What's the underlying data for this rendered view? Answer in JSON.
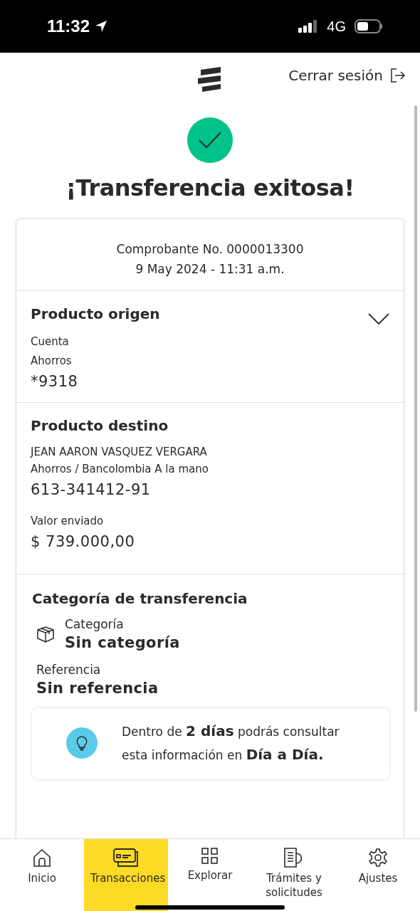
{
  "status_bar": {
    "time": "11:32",
    "network": "4G"
  },
  "header": {
    "logout": "Cerrar sesión"
  },
  "title": "¡Transferencia exitosa!",
  "receipt": {
    "number": "Comprobante No. 0000013300",
    "date": "9 May 2024 - 11:31 a.m."
  },
  "origin": {
    "heading": "Producto origen",
    "expanded": false,
    "type": "Cuenta",
    "subtype": "Ahorros",
    "account": "*9318"
  },
  "destination": {
    "heading": "Producto destino",
    "name": "JEAN AARON VASQUEZ VERGARA",
    "bank": "Ahorros / Bancolombia A la mano",
    "account": "613-341412-91",
    "amount_label": "Valor enviado",
    "amount": "$ 739.000,00"
  },
  "category": {
    "heading": "Categoría de transferencia",
    "category_label": "Categoría",
    "category_value": "Sin categoría",
    "reference_label": "Referencia",
    "reference_value": "Sin referencia"
  },
  "tip": "Dentro de **2 días** podrás consultar esta información en **Día a Día.**",
  "nav": [
    {
      "label": "Inicio",
      "kind": "home",
      "selected": false
    },
    {
      "label": "Transacciones",
      "kind": "cards",
      "selected": true
    },
    {
      "label": "Explorar",
      "kind": "grid",
      "selected": false
    },
    {
      "label": "Trámites y solicitudes",
      "kind": "docs",
      "selected": false
    },
    {
      "label": "Ajustes",
      "kind": "gear",
      "selected": false
    }
  ]
}
